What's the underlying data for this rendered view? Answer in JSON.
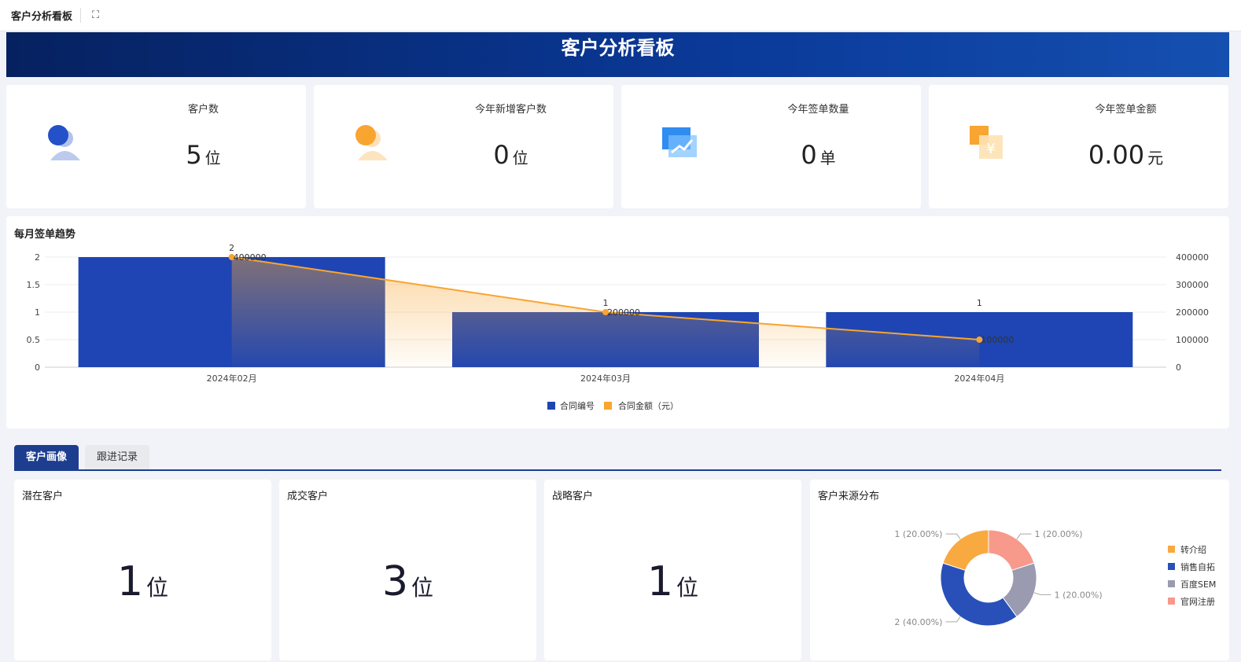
{
  "header": {
    "title": "客户分析看板",
    "fullscreen_icon": "fullscreen-icon"
  },
  "banner": {
    "title": "客户分析看板"
  },
  "kpis": [
    {
      "label": "客户数",
      "value": "5",
      "unit": "位",
      "icon": "customer-trend-icon",
      "color": "#2450c8"
    },
    {
      "label": "今年新增客户数",
      "value": "0",
      "unit": "位",
      "icon": "add-customer-icon",
      "color": "#f8a531"
    },
    {
      "label": "今年签单数量",
      "value": "0",
      "unit": "单",
      "icon": "contract-trend-icon",
      "color": "#2f8cf0"
    },
    {
      "label": "今年签单金额",
      "value": "0.00",
      "unit": "元",
      "icon": "money-icon",
      "color": "#f8a531"
    }
  ],
  "trend": {
    "title": "每月签单趋势"
  },
  "chart_data": [
    {
      "type": "bar+line",
      "title": "每月签单趋势",
      "categories": [
        "2024年02月",
        "2024年03月",
        "2024年04月"
      ],
      "series": [
        {
          "name": "合同编号",
          "type": "bar",
          "axis": "left",
          "values": [
            2,
            1,
            1
          ],
          "color": "#1e45b3"
        },
        {
          "name": "合同金额（元）",
          "type": "line",
          "axis": "right",
          "values": [
            400000,
            200000,
            100000
          ],
          "color": "#f8a531"
        }
      ],
      "left_ticks": [
        "0",
        "0.5",
        "1",
        "1.5",
        "2"
      ],
      "right_ticks": [
        "0",
        "100000",
        "200000",
        "300000",
        "400000"
      ],
      "ylim_left": [
        0,
        2
      ],
      "ylim_right": [
        0,
        400000
      ],
      "legend": "bottom-center"
    },
    {
      "type": "pie",
      "title": "客户来源分布",
      "donut": true,
      "slices": [
        {
          "name": "官网注册",
          "value": 1,
          "label": "1 (20.00%)",
          "color": "#f7998b"
        },
        {
          "name": "百度SEM",
          "value": 1,
          "label": "1 (20.00%)",
          "color": "#9a9ab0"
        },
        {
          "name": "销售自拓",
          "value": 2,
          "label": "2 (40.00%)",
          "color": "#2850b8"
        },
        {
          "name": "转介绍",
          "value": 1,
          "label": "1 (20.00%)",
          "color": "#f8aa40"
        }
      ],
      "legend_order": [
        "转介绍",
        "销售自拓",
        "百度SEM",
        "官网注册"
      ],
      "legend": "right"
    }
  ],
  "tabs": [
    {
      "label": "客户画像",
      "active": true
    },
    {
      "label": "跟进记录",
      "active": false
    }
  ],
  "stats": [
    {
      "label": "潜在客户",
      "value": "1",
      "unit": "位"
    },
    {
      "label": "成交客户",
      "value": "3",
      "unit": "位"
    },
    {
      "label": "战略客户",
      "value": "1",
      "unit": "位"
    }
  ],
  "pie": {
    "title": "客户来源分布"
  }
}
